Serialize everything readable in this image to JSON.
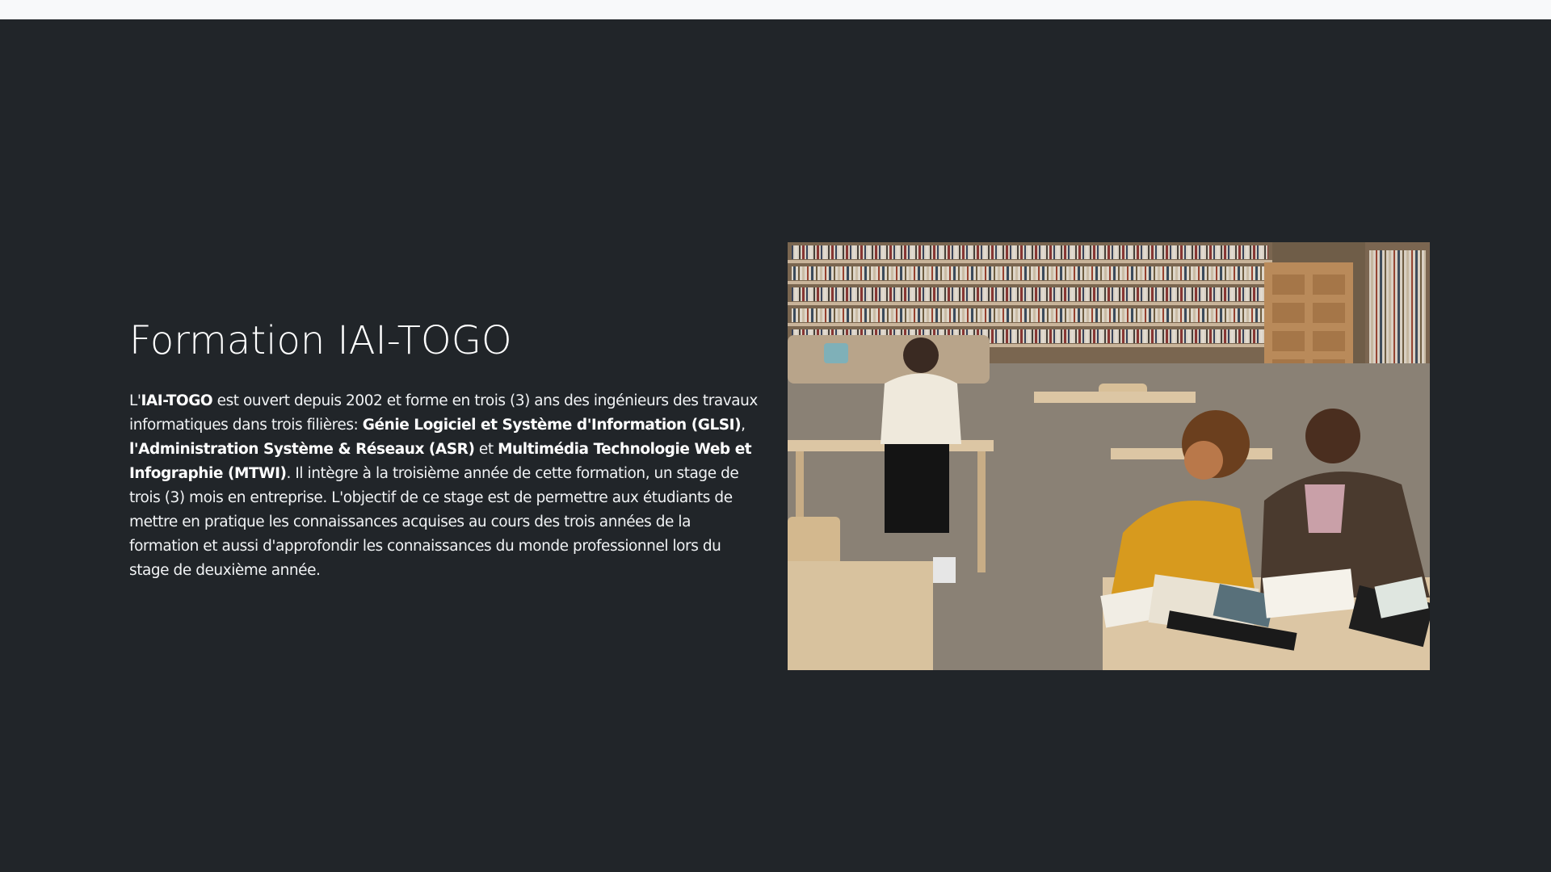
{
  "section": {
    "title": "Formation IAI-TOGO",
    "paragraph": [
      {
        "text": "L'",
        "bold": false
      },
      {
        "text": "IAI-TOGO",
        "bold": true
      },
      {
        "text": " est ouvert depuis 2002 et forme en trois (3) ans des ingénieurs des travaux informatiques dans trois filières: ",
        "bold": false
      },
      {
        "text": "Génie Logiciel et Système d'Information (GLSI)",
        "bold": true
      },
      {
        "text": ", ",
        "bold": false
      },
      {
        "text": "l'Administration Système & Réseaux (ASR)",
        "bold": true
      },
      {
        "text": " et ",
        "bold": false
      },
      {
        "text": "Multimédia Technologie Web et Infographie (MTWI)",
        "bold": true
      },
      {
        "text": ". Il intègre à la troisième année de cette formation, un stage de trois (3) mois en entreprise. L'objectif de ce stage est de permettre aux étudiants de mettre en pratique les connaissances acquises au cours des trois années de la formation et aussi d'approfondir les connaissances du monde professionnel lors du stage de deuxième année.",
        "bold": false
      }
    ]
  },
  "image": {
    "icon": "library-students-photo"
  },
  "colors": {
    "background": "#212529",
    "topbar": "#f8f9fa",
    "text": "#ffffff"
  }
}
